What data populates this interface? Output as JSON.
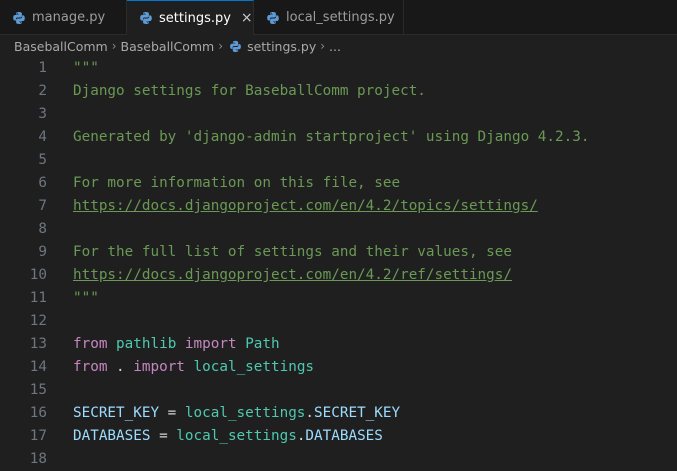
{
  "tabs": [
    {
      "label": "manage.py",
      "active": false
    },
    {
      "label": "settings.py",
      "active": true,
      "close": "×"
    },
    {
      "label": "local_settings.py",
      "active": false
    }
  ],
  "breadcrumb": {
    "items": [
      "BaseballComm",
      "BaseballComm",
      "settings.py",
      "..."
    ],
    "separator": "›"
  },
  "colors": {
    "accent": "#0078d4",
    "string": "#6a9955",
    "keyword": "#c586c0",
    "module": "#4ec9b0",
    "variable": "#9cdcfe",
    "constant": "#4fc1ff",
    "python_icon_blue": "#3572a5",
    "python_icon_yellow": "#ffd43b"
  },
  "editor": {
    "lines": [
      {
        "n": "1",
        "tokens": [
          {
            "t": "\"\"\"",
            "c": "str"
          }
        ]
      },
      {
        "n": "2",
        "tokens": [
          {
            "t": "Django settings for BaseballComm project.",
            "c": "str"
          }
        ]
      },
      {
        "n": "3",
        "tokens": []
      },
      {
        "n": "4",
        "tokens": [
          {
            "t": "Generated by 'django-admin startproject' using Django 4.2.3.",
            "c": "str"
          }
        ]
      },
      {
        "n": "5",
        "tokens": []
      },
      {
        "n": "6",
        "tokens": [
          {
            "t": "For more information on this file, see",
            "c": "str"
          }
        ]
      },
      {
        "n": "7",
        "tokens": [
          {
            "t": "https://docs.djangoproject.com/en/4.2/topics/settings/",
            "c": "link"
          }
        ]
      },
      {
        "n": "8",
        "tokens": []
      },
      {
        "n": "9",
        "tokens": [
          {
            "t": "For the full list of settings and their values, see",
            "c": "str"
          }
        ]
      },
      {
        "n": "10",
        "tokens": [
          {
            "t": "https://docs.djangoproject.com/en/4.2/ref/settings/",
            "c": "link"
          }
        ]
      },
      {
        "n": "11",
        "tokens": [
          {
            "t": "\"\"\"",
            "c": "str"
          }
        ]
      },
      {
        "n": "12",
        "tokens": []
      },
      {
        "n": "13",
        "tokens": [
          {
            "t": "from",
            "c": "kw"
          },
          {
            "t": " ",
            "c": "plain"
          },
          {
            "t": "pathlib",
            "c": "mod"
          },
          {
            "t": " ",
            "c": "plain"
          },
          {
            "t": "import",
            "c": "kw"
          },
          {
            "t": " ",
            "c": "plain"
          },
          {
            "t": "Path",
            "c": "cls"
          }
        ]
      },
      {
        "n": "14",
        "tokens": [
          {
            "t": "from",
            "c": "kw"
          },
          {
            "t": " . ",
            "c": "plain"
          },
          {
            "t": "import",
            "c": "kw"
          },
          {
            "t": " ",
            "c": "plain"
          },
          {
            "t": "local_settings",
            "c": "mod"
          }
        ]
      },
      {
        "n": "15",
        "tokens": []
      },
      {
        "n": "16",
        "tokens": [
          {
            "t": "SECRET_KEY",
            "c": "var"
          },
          {
            "t": " = ",
            "c": "plain"
          },
          {
            "t": "local_settings",
            "c": "mod"
          },
          {
            "t": ".",
            "c": "plain"
          },
          {
            "t": "SECRET_KEY",
            "c": "var"
          }
        ]
      },
      {
        "n": "17",
        "tokens": [
          {
            "t": "DATABASES",
            "c": "var"
          },
          {
            "t": " = ",
            "c": "plain"
          },
          {
            "t": "local_settings",
            "c": "mod"
          },
          {
            "t": ".",
            "c": "plain"
          },
          {
            "t": "DATABASES",
            "c": "var"
          }
        ]
      },
      {
        "n": "18",
        "tokens": []
      }
    ]
  }
}
